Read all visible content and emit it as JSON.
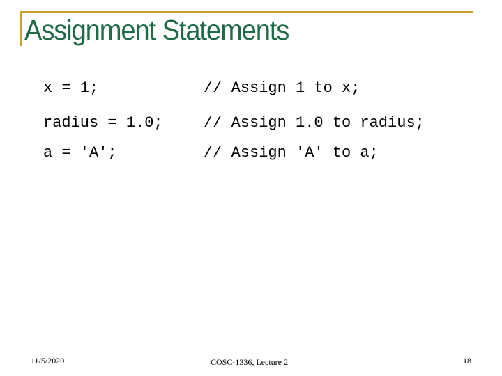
{
  "slide": {
    "title": "Assignment Statements",
    "accent_color": "#C9A227",
    "title_color": "#1E6B45",
    "code_rows": [
      {
        "statement": "x = 1;",
        "comment": "// Assign 1 to x;"
      },
      {
        "statement": "radius = 1.0;",
        "comment": "// Assign 1.0 to radius;"
      },
      {
        "statement": "a = 'A';",
        "comment": "// Assign 'A' to a;"
      }
    ],
    "footer": {
      "date": "11/5/2020",
      "course": "COSC-1336, Lecture 2",
      "page_number": "18"
    }
  }
}
